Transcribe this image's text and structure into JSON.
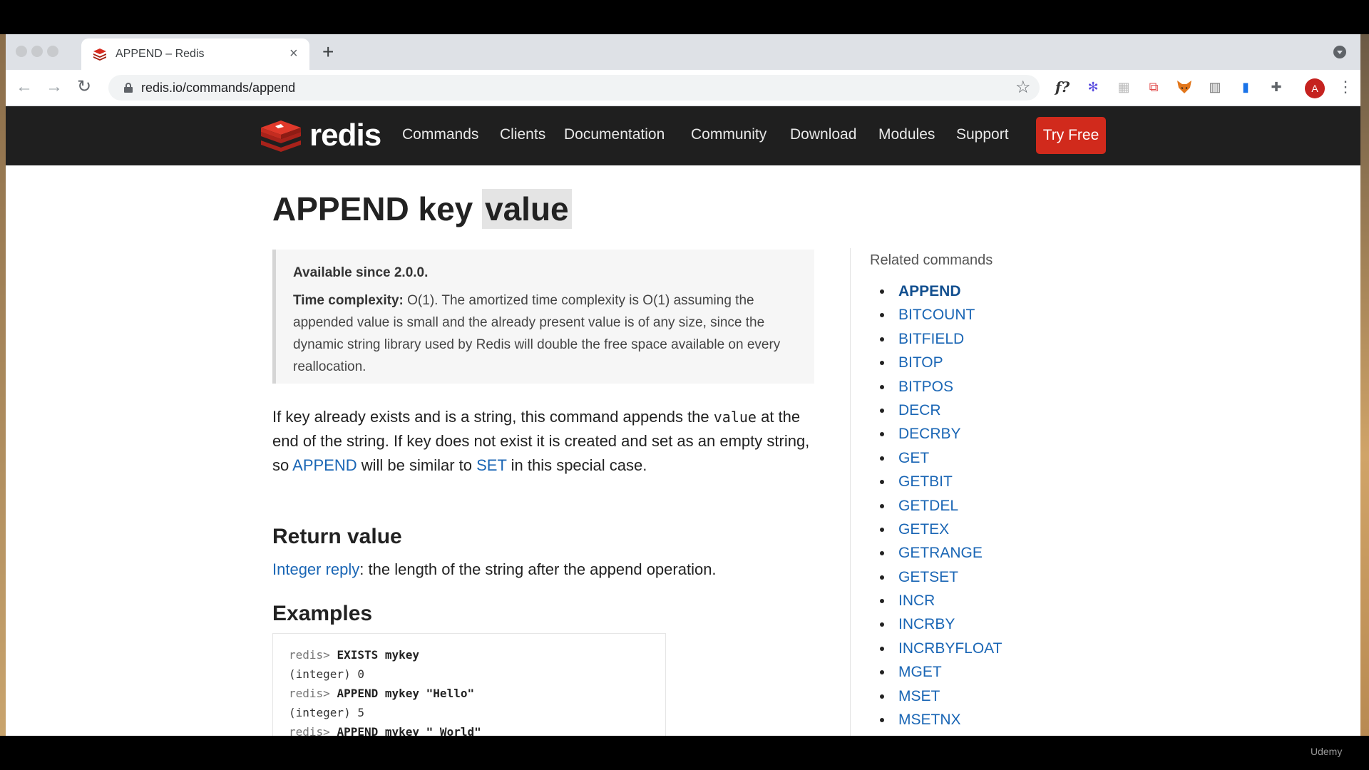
{
  "browser": {
    "tab_title": "APPEND – Redis",
    "tab_close": "×",
    "new_tab": "+",
    "url": "redis.io/commands/append",
    "back": "←",
    "forward": "→",
    "reload": "↻",
    "star": "☆",
    "extensions": [
      {
        "name": "f-extension-icon",
        "glyph": "f?"
      },
      {
        "name": "gear-extension-icon",
        "glyph": "✻"
      },
      {
        "name": "grid-extension-icon",
        "glyph": "▦"
      },
      {
        "name": "badge-extension-icon",
        "glyph": "⧉"
      },
      {
        "name": "fox-extension-icon",
        "glyph": "🦊"
      },
      {
        "name": "chart-extension-icon",
        "glyph": "▥"
      },
      {
        "name": "book-extension-icon",
        "glyph": "▮"
      },
      {
        "name": "puzzle-extension-icon",
        "glyph": "✚"
      }
    ],
    "avatar_letter": "A",
    "menu": "⋮"
  },
  "header": {
    "logo_text": "redis",
    "nav": [
      "Commands",
      "Clients",
      "Documentation",
      "Community",
      "Download",
      "Modules",
      "Support"
    ],
    "try_free": "Try Free"
  },
  "main": {
    "title_cmd": "APPEND key",
    "title_hl": "value",
    "since": "Available since 2.0.0.",
    "complexity_label": "Time complexity:",
    "complexity_text": " O(1). The amortized time complexity is O(1) assuming the appended value is small and the already present value is of any size, since the dynamic string library used by Redis will double the free space available on every reallocation.",
    "para_1": "If key already exists and is a string, this command appends the ",
    "para_code": "value",
    "para_2": " at the end of the string. If key does not exist it is created and set as an empty string, so ",
    "para_link_append": "APPEND",
    "para_3": " will be similar to ",
    "para_link_set": "SET",
    "para_4": " in this special case.",
    "return_heading": "Return value",
    "return_link": "Integer reply",
    "return_text": ": the length of the string after the append operation.",
    "examples_heading": "Examples",
    "code": [
      {
        "prompt": "redis> ",
        "cmd": "EXISTS mykey"
      },
      {
        "prompt": "(integer) 0",
        "cmd": ""
      },
      {
        "prompt": "redis> ",
        "cmd": "APPEND mykey \"Hello\""
      },
      {
        "prompt": "(integer) 5",
        "cmd": ""
      },
      {
        "prompt": "redis> ",
        "cmd": "APPEND mykey \" World\""
      }
    ]
  },
  "sidebar": {
    "title": "Related commands",
    "commands": [
      "APPEND",
      "BITCOUNT",
      "BITFIELD",
      "BITOP",
      "BITPOS",
      "DECR",
      "DECRBY",
      "GET",
      "GETBIT",
      "GETDEL",
      "GETEX",
      "GETRANGE",
      "GETSET",
      "INCR",
      "INCRBY",
      "INCRBYFLOAT",
      "MGET",
      "MSET",
      "MSETNX"
    ],
    "active": "APPEND"
  },
  "watermark": "Udemy",
  "colors": {
    "link": "#1a66b5",
    "header_bg": "#1f1f1f",
    "try_free": "#d12a1c"
  }
}
